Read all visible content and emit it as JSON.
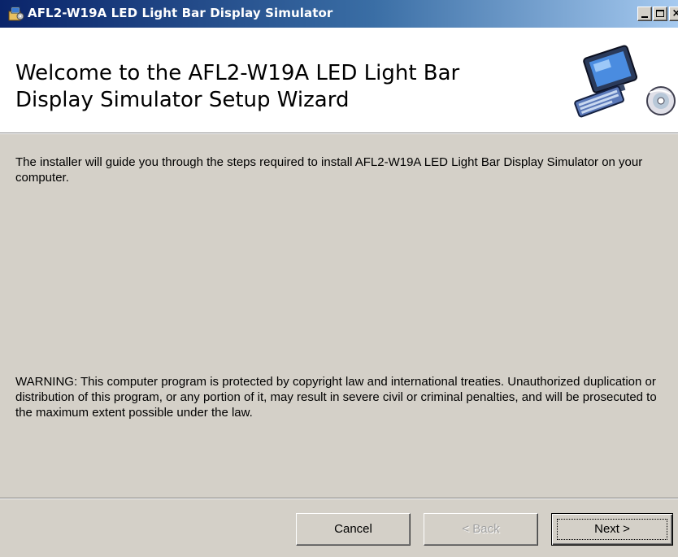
{
  "window": {
    "title": "AFL2-W19A LED Light Bar Display Simulator",
    "icons": {
      "app": "installer-icon",
      "minimize": "minimize-icon",
      "maximize": "maximize-icon",
      "close": "close-icon"
    }
  },
  "banner": {
    "title_line1": "Welcome to the AFL2-W19A LED Light Bar",
    "title_line2": "Display Simulator Setup Wizard",
    "graphic": "computer-setup-icon"
  },
  "body": {
    "intro": "The installer will guide you through the steps required to install AFL2-W19A LED Light Bar Display Simulator on your computer.",
    "warning": "WARNING: This computer program is protected by copyright law and international treaties. Unauthorized duplication or distribution of this program, or any portion of it, may result in severe civil or criminal penalties, and will be prosecuted to the maximum extent possible under the law."
  },
  "buttons": {
    "cancel": "Cancel",
    "back": "< Back",
    "next": "Next >"
  },
  "colors": {
    "titlebar_start": "#0a246a",
    "titlebar_end": "#a6caf0",
    "face": "#d4d0c8",
    "disabled_text": "#a0a0a0"
  }
}
